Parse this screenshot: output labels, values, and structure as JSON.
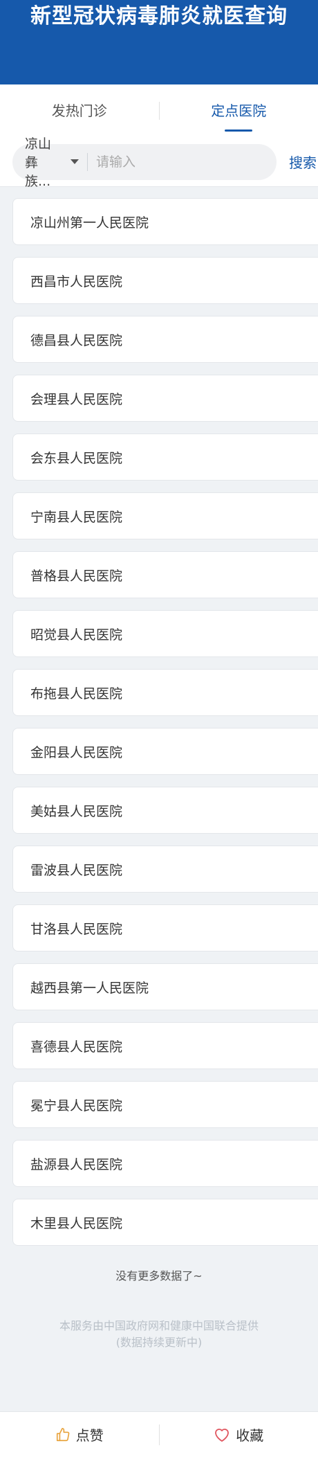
{
  "header": {
    "title": "新型冠状病毒肺炎就医查询"
  },
  "tabs": [
    {
      "label": "发热门诊"
    },
    {
      "label": "定点医院"
    }
  ],
  "search": {
    "region": "凉山彝族...",
    "placeholder": "请输入",
    "button": "搜索"
  },
  "hospitals": [
    "凉山州第一人民医院",
    "西昌市人民医院",
    "德昌县人民医院",
    "会理县人民医院",
    "会东县人民医院",
    "宁南县人民医院",
    "普格县人民医院",
    "昭觉县人民医院",
    "布拖县人民医院",
    "金阳县人民医院",
    "美姑县人民医院",
    "雷波县人民医院",
    "甘洛县人民医院",
    "越西县第一人民医院",
    "喜德县人民医院",
    "冕宁县人民医院",
    "盐源县人民医院",
    "木里县人民医院"
  ],
  "no_more": "没有更多数据了~",
  "footer": {
    "line1": "本服务由中国政府网和健康中国联合提供",
    "line2": "(数据持续更新中)"
  },
  "bottom": {
    "like": "点赞",
    "favorite": "收藏"
  },
  "colors": {
    "brand": "#1659ab",
    "like_icon": "#e8a33d",
    "favorite_icon": "#e0545e"
  }
}
